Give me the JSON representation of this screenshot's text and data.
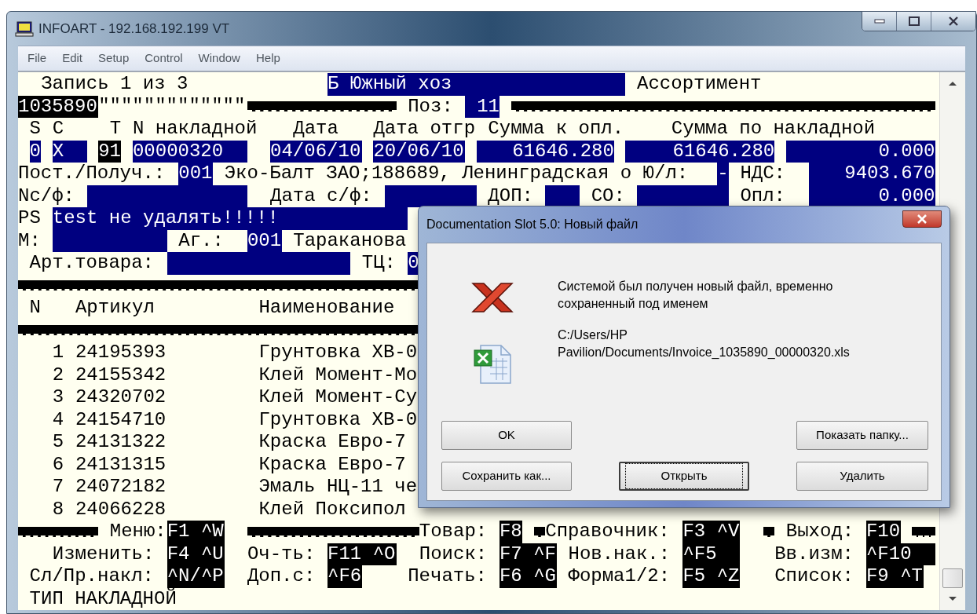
{
  "window": {
    "title": "INFOART - 192.168.192.199 VT"
  },
  "menu": [
    "File",
    "Edit",
    "Setup",
    "Control",
    "Window",
    "Help"
  ],
  "terminal": {
    "lines": [
      [
        {
          "kind": "text",
          "text": "Запись 1 из 3"
        },
        {
          "kind": "field",
          "text": "Б Южный хоз"
        },
        {
          "kind": "text",
          "text": "Ассортимент"
        }
      ],
      [
        {
          "kind": "inverse",
          "text": "1035890"
        },
        {
          "kind": "text",
          "text": "\"\"\"\"\"\"\"\"\"\"\"\"\""
        },
        {
          "kind": "rule"
        },
        {
          "kind": "text",
          "text": "Поз:"
        },
        {
          "kind": "field",
          "text": "11"
        },
        {
          "kind": "rule"
        }
      ],
      [
        {
          "kind": "text",
          "text": "S"
        },
        {
          "kind": "text",
          "text": "C"
        },
        {
          "kind": "text",
          "text": "T"
        },
        {
          "kind": "text",
          "text": "N накладной"
        },
        {
          "kind": "text",
          "text": "Дата"
        },
        {
          "kind": "text",
          "text": "Дата отгр"
        },
        {
          "kind": "text",
          "text": "Сумма к опл."
        },
        {
          "kind": "text",
          "text": "Сумма по накладной"
        }
      ],
      [
        {
          "kind": "field",
          "text": "0"
        },
        {
          "kind": "field",
          "text": "X"
        },
        {
          "kind": "inverse",
          "text": "91"
        },
        {
          "kind": "field",
          "text": "00000320"
        },
        {
          "kind": "field",
          "text": "04/06/10"
        },
        {
          "kind": "field",
          "text": "20/06/10"
        },
        {
          "kind": "field",
          "text": "61646.280"
        },
        {
          "kind": "field",
          "text": "61646.280"
        },
        {
          "kind": "field",
          "text": "0.000"
        }
      ],
      [
        {
          "kind": "text",
          "text": "Пост./Получ.:"
        },
        {
          "kind": "field",
          "text": "001"
        },
        {
          "kind": "text",
          "text": "Эко-Балт ЗАО;188689, Ленинградская о Ю/л:"
        },
        {
          "kind": "field",
          "text": "-"
        },
        {
          "kind": "text",
          "text": "НДС:"
        },
        {
          "kind": "field",
          "text": "9403.670"
        }
      ],
      [
        {
          "kind": "text",
          "text": "Nc/ф:"
        },
        {
          "kind": "field"
        },
        {
          "kind": "text",
          "text": "Дата с/ф:"
        },
        {
          "kind": "field"
        },
        {
          "kind": "text",
          "text": "ДОП:"
        },
        {
          "kind": "field"
        },
        {
          "kind": "text",
          "text": "СО:"
        },
        {
          "kind": "field"
        },
        {
          "kind": "text",
          "text": "Опл:"
        },
        {
          "kind": "field",
          "text": "0.000"
        }
      ],
      [
        {
          "kind": "text",
          "text": "PS"
        },
        {
          "kind": "field",
          "text": "test не удалять!!!!!"
        }
      ],
      [
        {
          "kind": "text",
          "text": "М:"
        },
        {
          "kind": "field"
        },
        {
          "kind": "text",
          "text": "Аг.:"
        },
        {
          "kind": "field",
          "text": "001"
        },
        {
          "kind": "text",
          "text": "Тараканова"
        }
      ],
      [
        {
          "kind": "text",
          "text": "Арт.товара:"
        },
        {
          "kind": "field"
        },
        {
          "kind": "text",
          "text": "ТЦ:"
        },
        {
          "kind": "field",
          "text": "0"
        }
      ],
      [
        {
          "kind": "rule"
        }
      ],
      [
        {
          "kind": "text",
          "text": "N"
        },
        {
          "kind": "text",
          "text": "Артикул"
        },
        {
          "kind": "text",
          "text": "Наименование"
        }
      ],
      [
        {
          "kind": "rule"
        }
      ],
      [
        {
          "kind": "text",
          "text": "1"
        },
        {
          "kind": "text",
          "text": "24195393"
        },
        {
          "kind": "text",
          "text": "Грунтовка ХВ-0"
        }
      ],
      [
        {
          "kind": "text",
          "text": "2"
        },
        {
          "kind": "text",
          "text": "24155342"
        },
        {
          "kind": "text",
          "text": "Клей Момент-Мо"
        }
      ],
      [
        {
          "kind": "text",
          "text": "3"
        },
        {
          "kind": "text",
          "text": "24320702"
        },
        {
          "kind": "text",
          "text": "Клей Момент-Су"
        }
      ],
      [
        {
          "kind": "text",
          "text": "4"
        },
        {
          "kind": "text",
          "text": "24154710"
        },
        {
          "kind": "text",
          "text": "Грунтовка ХВ-0"
        }
      ],
      [
        {
          "kind": "text",
          "text": "5"
        },
        {
          "kind": "text",
          "text": "24131322"
        },
        {
          "kind": "text",
          "text": "Краска Евро-7"
        }
      ],
      [
        {
          "kind": "text",
          "text": "6"
        },
        {
          "kind": "text",
          "text": "24131315"
        },
        {
          "kind": "text",
          "text": "Краска Евро-7"
        }
      ],
      [
        {
          "kind": "text",
          "text": "7"
        },
        {
          "kind": "text",
          "text": "24072182"
        },
        {
          "kind": "text",
          "text": "Эмаль НЦ-11 че"
        }
      ],
      [
        {
          "kind": "text",
          "text": "8"
        },
        {
          "kind": "text",
          "text": "24066228"
        },
        {
          "kind": "text",
          "text": "Клей Поксипол"
        }
      ],
      [
        {
          "kind": "rule"
        },
        {
          "kind": "text",
          "text": "Меню:"
        },
        {
          "kind": "inverse",
          "text": "F1 ^W"
        },
        {
          "kind": "rule"
        },
        {
          "kind": "text",
          "text": "Товар:"
        },
        {
          "kind": "inverse",
          "text": "F8"
        },
        {
          "kind": "rule"
        },
        {
          "kind": "text",
          "text": "Справочник:"
        },
        {
          "kind": "inverse",
          "text": "F3 ^V"
        },
        {
          "kind": "rule"
        },
        {
          "kind": "text",
          "text": "Выход:"
        },
        {
          "kind": "inverse",
          "text": "F10"
        },
        {
          "kind": "rule"
        }
      ],
      [
        {
          "kind": "text",
          "text": "Изменить:"
        },
        {
          "kind": "inverse",
          "text": "F4 ^U"
        },
        {
          "kind": "text",
          "text": "Оч-ть:"
        },
        {
          "kind": "inverse",
          "text": "F11 ^O"
        },
        {
          "kind": "text",
          "text": "Поиск:"
        },
        {
          "kind": "inverse",
          "text": "F7 ^F"
        },
        {
          "kind": "text",
          "text": "Нов.нак.:"
        },
        {
          "kind": "inverse",
          "text": "^F5"
        },
        {
          "kind": "text",
          "text": "Вв.изм:"
        },
        {
          "kind": "inverse",
          "text": "^F10"
        }
      ],
      [
        {
          "kind": "text",
          "text": "Сл/Пр.накл:"
        },
        {
          "kind": "inverse",
          "text": "^N/^P"
        },
        {
          "kind": "text",
          "text": "Доп.с:"
        },
        {
          "kind": "inverse",
          "text": "^F6"
        },
        {
          "kind": "text",
          "text": "Печать:"
        },
        {
          "kind": "inverse",
          "text": "F6 ^G"
        },
        {
          "kind": "text",
          "text": "Форма1/2:"
        },
        {
          "kind": "inverse",
          "text": "F5 ^Z"
        },
        {
          "kind": "text",
          "text": "Список:"
        },
        {
          "kind": "inverse",
          "text": "F9 ^T"
        }
      ],
      [
        {
          "kind": "text",
          "text": "ТИП НАКЛАДНОЙ"
        }
      ]
    ]
  },
  "dialog": {
    "title": "Documentation Slot 5.0: Новый файл",
    "message": "Системой был получен новый файл, временно сохраненный под именем",
    "path": "C:/Users/HP Pavilion/Documents/Invoice_1035890_00000320.xls",
    "buttons": [
      {
        "label": "OK",
        "focused": false
      },
      {
        "label": "Показать папку...",
        "focused": false
      },
      {
        "label": "Сохранить как...",
        "focused": false
      },
      {
        "label": "Открыть",
        "focused": true
      },
      {
        "label": "Удалить",
        "focused": false
      }
    ]
  }
}
